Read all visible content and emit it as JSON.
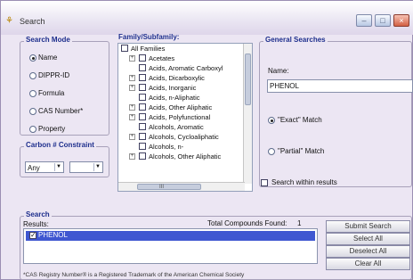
{
  "window": {
    "title": "Search",
    "controls": [
      "minimize",
      "maximize",
      "close"
    ]
  },
  "search_mode": {
    "title": "Search Mode",
    "options": [
      {
        "label": "Name",
        "checked": true
      },
      {
        "label": "DIPPR-ID",
        "checked": false
      },
      {
        "label": "Formula",
        "checked": false
      },
      {
        "label": "CAS Number*",
        "checked": false
      },
      {
        "label": "Property",
        "checked": false
      }
    ]
  },
  "carbon_constraint": {
    "title": "Carbon # Constraint",
    "select1_value": "Any",
    "select2_value": ""
  },
  "family": {
    "title": "Family/Subfamily:",
    "items": [
      "All Families",
      "Acetates",
      "Acids, Aromatic Carboxyl",
      "Acids, Dicarboxylic",
      "Acids, Inorganic",
      "Acids, n-Aliphatic",
      "Acids, Other Aliphatic",
      "Acids, Polyfunctional",
      "Alcohols, Aromatic",
      "Alcohols, Cycloaliphatic",
      "Alcohols, n-",
      "Alcohols, Other Aliphatic"
    ],
    "scroll_hint": "III"
  },
  "general": {
    "title": "General Searches",
    "name_label": "Name:",
    "name_value": "PHENOL",
    "exact_label": "\"Exact\" Match",
    "partial_label": "\"Partial\" Match",
    "exact_checked": true,
    "partial_checked": false,
    "within_label": "Search within results",
    "within_checked": false
  },
  "results": {
    "title": "Search",
    "subtitle": "Results:",
    "count_label": "Total Compounds Found:",
    "count": "1",
    "items": [
      "PHENOL"
    ]
  },
  "buttons": {
    "submit": "Submit Search",
    "select_all": "Select All",
    "deselect_all": "Deselect All",
    "clear_all": "Clear All"
  },
  "footer": "*CAS Registry Number® is a Registered Trademark of the American Chemical Society",
  "colors": {
    "accent": "#1e2f8d",
    "selection": "#3f57d1",
    "close": "#d25f43"
  }
}
